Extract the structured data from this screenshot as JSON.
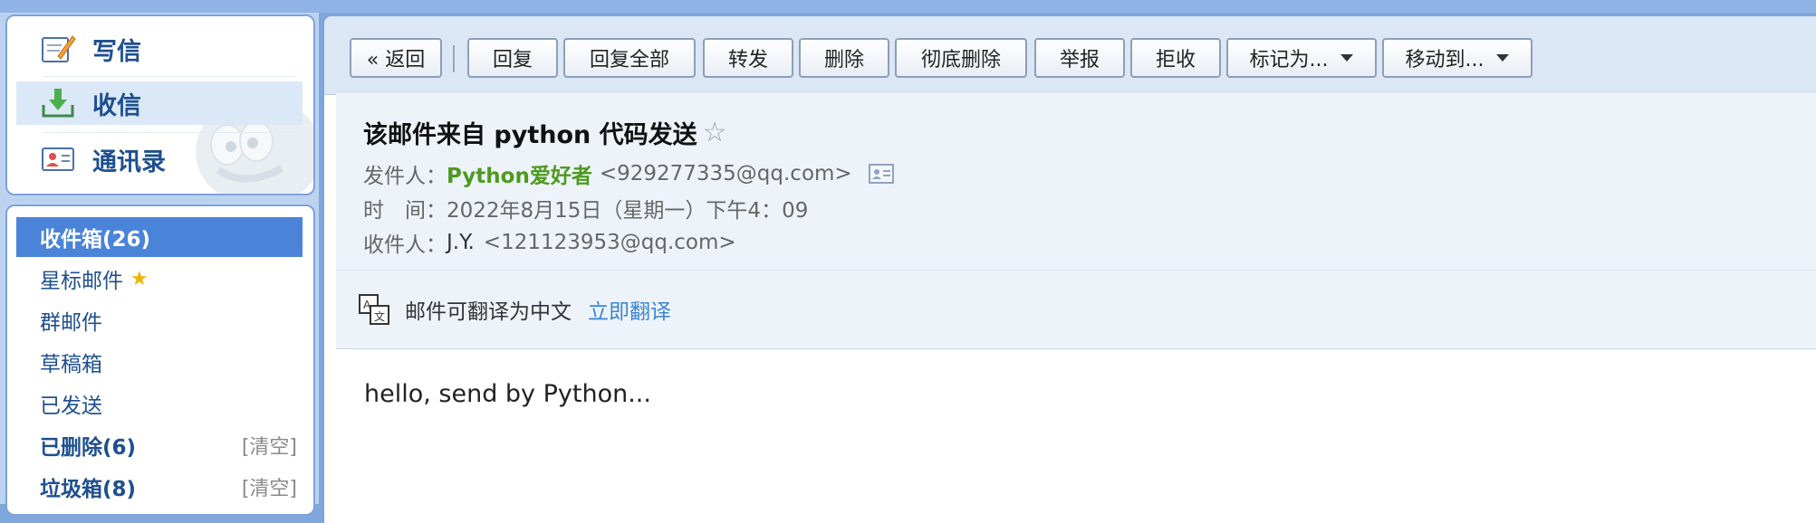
{
  "nav": {
    "compose": "写信",
    "inbox": "收信",
    "contacts": "通讯录"
  },
  "folders": {
    "inbox": "收件箱(26)",
    "starred": "星标邮件",
    "group": "群邮件",
    "drafts": "草稿箱",
    "sent": "已发送",
    "deleted": "已删除(6)",
    "spam": "垃圾箱(8)",
    "clear": "[清空]"
  },
  "toolbar": {
    "back": "« 返回",
    "reply": "回复",
    "reply_all": "回复全部",
    "forward": "转发",
    "delete": "删除",
    "delete_permanently": "彻底删除",
    "report": "举报",
    "reject": "拒收",
    "mark_as": "标记为...",
    "move_to": "移动到..."
  },
  "email": {
    "subject": "该邮件来自 python 代码发送",
    "from_label": "发件人：",
    "from_name": "Python爱好者",
    "from_addr": "<929277335@qq.com>",
    "time_label": "时　间：",
    "time_value": "2022年8月15日（星期一）下午4：09",
    "to_label": "收件人：",
    "to_name": "J.Y.",
    "to_addr": "<121123953@qq.com>",
    "translate_text": "邮件可翻译为中文",
    "translate_link": "立即翻译",
    "body": "hello, send by Python..."
  },
  "colors": {
    "accent": "#4a84d8",
    "sender": "#4d9a1f",
    "link": "#3b86d6"
  }
}
